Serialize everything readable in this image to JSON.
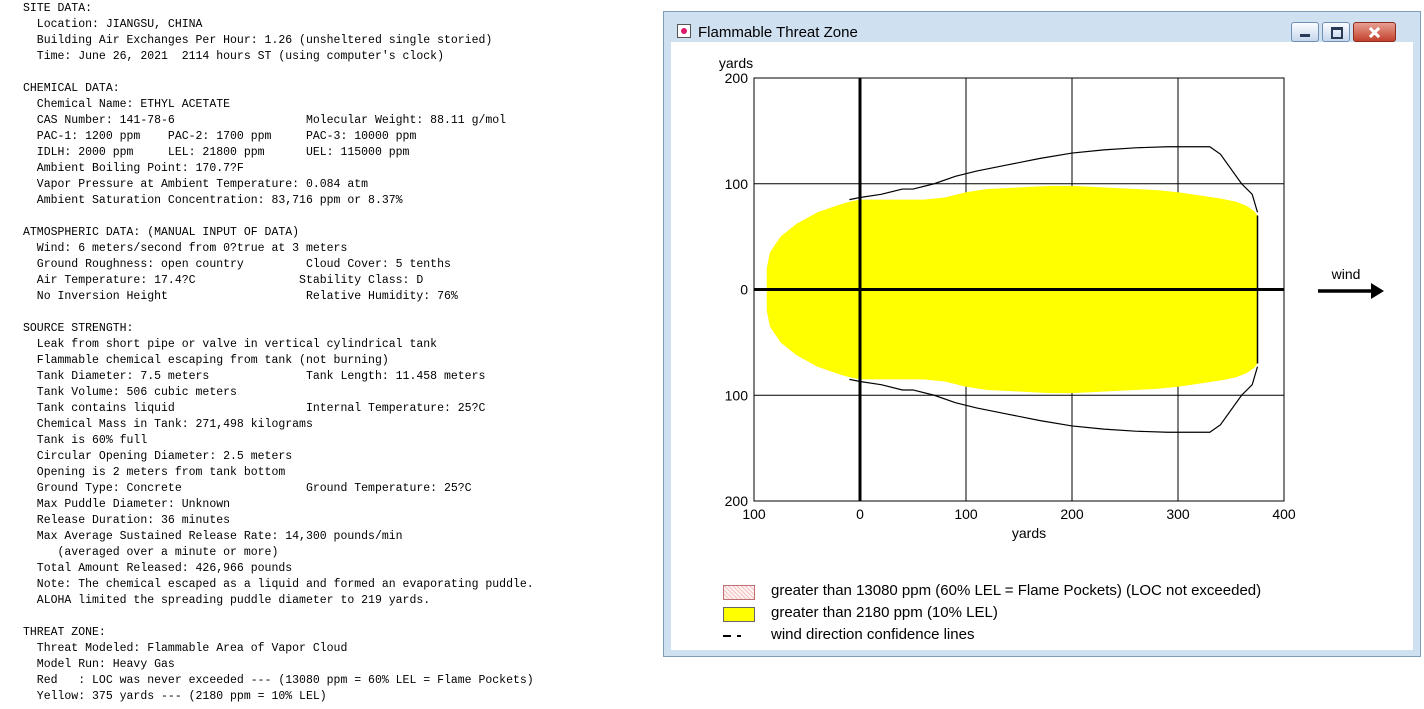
{
  "report_lines": [
    "SITE DATA:",
    "  Location: JIANGSU, CHINA",
    "  Building Air Exchanges Per Hour: 1.26 (unsheltered single storied)",
    "  Time: June 26, 2021  2114 hours ST (using computer's clock)",
    "",
    "CHEMICAL DATA:",
    "  Chemical Name: ETHYL ACETATE",
    "  CAS Number: 141-78-6                   Molecular Weight: 88.11 g/mol",
    "  PAC-1: 1200 ppm    PAC-2: 1700 ppm     PAC-3: 10000 ppm",
    "  IDLH: 2000 ppm     LEL: 21800 ppm      UEL: 115000 ppm",
    "  Ambient Boiling Point: 170.7?F",
    "  Vapor Pressure at Ambient Temperature: 0.084 atm",
    "  Ambient Saturation Concentration: 83,716 ppm or 8.37%",
    "",
    "ATMOSPHERIC DATA: (MANUAL INPUT OF DATA)",
    "  Wind: 6 meters/second from 0?true at 3 meters",
    "  Ground Roughness: open country         Cloud Cover: 5 tenths",
    "  Air Temperature: 17.4?C               Stability Class: D",
    "  No Inversion Height                    Relative Humidity: 76%",
    "",
    "SOURCE STRENGTH:",
    "  Leak from short pipe or valve in vertical cylindrical tank",
    "  Flammable chemical escaping from tank (not burning)",
    "  Tank Diameter: 7.5 meters              Tank Length: 11.458 meters",
    "  Tank Volume: 506 cubic meters",
    "  Tank contains liquid                   Internal Temperature: 25?C",
    "  Chemical Mass in Tank: 271,498 kilograms",
    "  Tank is 60% full",
    "  Circular Opening Diameter: 2.5 meters",
    "  Opening is 2 meters from tank bottom",
    "  Ground Type: Concrete                  Ground Temperature: 25?C",
    "  Max Puddle Diameter: Unknown",
    "  Release Duration: 36 minutes",
    "  Max Average Sustained Release Rate: 14,300 pounds/min",
    "     (averaged over a minute or more)",
    "  Total Amount Released: 426,966 pounds",
    "  Note: The chemical escaped as a liquid and formed an evaporating puddle.",
    "  ALOHA limited the spreading puddle diameter to 219 yards.",
    "",
    "THREAT ZONE:",
    "  Threat Modeled: Flammable Area of Vapor Cloud",
    "  Model Run: Heavy Gas",
    "  Red   : LOC was never exceeded --- (13080 ppm = 60% LEL = Flame Pockets)",
    "  Yellow: 375 yards --- (2180 ppm = 10% LEL)"
  ],
  "window": {
    "title": "Flammable Threat Zone",
    "icon": "app-icon",
    "buttons": [
      "minimize-icon",
      "maximize-icon",
      "close-icon"
    ]
  },
  "colors": {
    "yellow_zone": "#ffff00",
    "red_zone": "#f4c0c0",
    "window_frame": "#cfe0f1",
    "close_button": "#c2412d"
  },
  "chart_data": {
    "type": "area",
    "xlabel": "yards",
    "ylabel": "yards",
    "x_ticks": [
      "100",
      "0",
      "100",
      "200",
      "300",
      "400"
    ],
    "y_ticks": [
      "200",
      "100",
      "0",
      "100",
      "200"
    ],
    "xlim": [
      -100,
      400
    ],
    "ylim": [
      -200,
      200
    ],
    "grid": true,
    "wind_label": "wind",
    "legend_entries": [
      "greater than 13080 ppm (60% LEL = Flame Pockets) (LOC not exceeded)",
      "greater than 2180 ppm (10% LEL)",
      "wind direction confidence lines"
    ],
    "series": [
      {
        "name": "greater than 2180 ppm (10% LEL)",
        "x": [
          -88,
          -85,
          -75,
          -60,
          -40,
          -20,
          -10,
          0,
          20,
          40,
          60,
          80,
          100,
          120,
          140,
          160,
          180,
          200,
          220,
          240,
          260,
          280,
          300,
          320,
          340,
          355,
          365,
          372,
          375
        ],
        "y": [
          20,
          35,
          50,
          62,
          73,
          80,
          83,
          85,
          85,
          85,
          85,
          87,
          92,
          95,
          96,
          97,
          98,
          98,
          97,
          96,
          95,
          94,
          92,
          89,
          86,
          83,
          79,
          74,
          70
        ]
      },
      {
        "name": "wind direction confidence lines",
        "x": [
          -10,
          0,
          20,
          40,
          50,
          70,
          90,
          110,
          140,
          170,
          200,
          230,
          260,
          290,
          310,
          330,
          340,
          360,
          370,
          375
        ],
        "y": [
          85,
          87,
          90,
          95,
          95,
          100,
          107,
          112,
          118,
          124,
          129,
          132,
          134,
          135,
          135,
          135,
          128,
          100,
          90,
          73
        ]
      }
    ]
  }
}
